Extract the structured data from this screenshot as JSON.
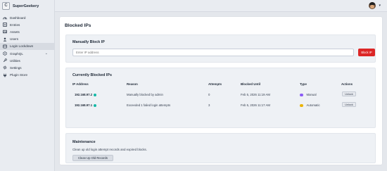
{
  "app": {
    "name": "SuperGeekery",
    "logo_letter": "C"
  },
  "sidebar": {
    "items": [
      {
        "label": "Dashboard",
        "icon": "dashboard-icon"
      },
      {
        "label": "Entries",
        "icon": "entries-icon"
      },
      {
        "label": "Assets",
        "icon": "assets-icon"
      },
      {
        "label": "Users",
        "icon": "users-icon"
      },
      {
        "label": "Login Lockdown",
        "icon": "lockdown-icon",
        "active": true
      },
      {
        "label": "GraphQL",
        "icon": "graphql-icon",
        "expandable": true
      },
      {
        "label": "Utilities",
        "icon": "utilities-icon"
      },
      {
        "label": "Settings",
        "icon": "settings-icon"
      },
      {
        "label": "Plugin Store",
        "icon": "plugin-store-icon"
      }
    ]
  },
  "page": {
    "title": "Blocked IPs"
  },
  "manual_block": {
    "title": "Manually Block IP",
    "input_placeholder": "Enter IP address",
    "button_label": "Block IP"
  },
  "blocked": {
    "title": "Currently Blocked IPs",
    "columns": [
      "IP Address",
      "Reason",
      "Attempts",
      "Blocked Until",
      "Type",
      "Actions"
    ],
    "rows": [
      {
        "ip": "192.168.97.2",
        "reason": "Manually blocked by admin",
        "attempts": "0",
        "until": "Feb 5, 2026 11:19 AM",
        "type": "Manual",
        "type_color": "#8b5cf6",
        "action": "Unlock"
      },
      {
        "ip": "192.168.97.1",
        "reason": "Exceeded 1 failed login attempts",
        "attempts": "3",
        "until": "Feb 5, 2026 11:17 AM",
        "type": "Automatic",
        "type_color": "#eab308",
        "action": "Unlock"
      }
    ]
  },
  "maintenance": {
    "title": "Maintenance",
    "description": "Clean up old login attempt records and expired blocks.",
    "button_label": "Clean Up Old Records"
  },
  "colors": {
    "accent_red": "#dc2626",
    "status_dot": "#14b8a6"
  }
}
